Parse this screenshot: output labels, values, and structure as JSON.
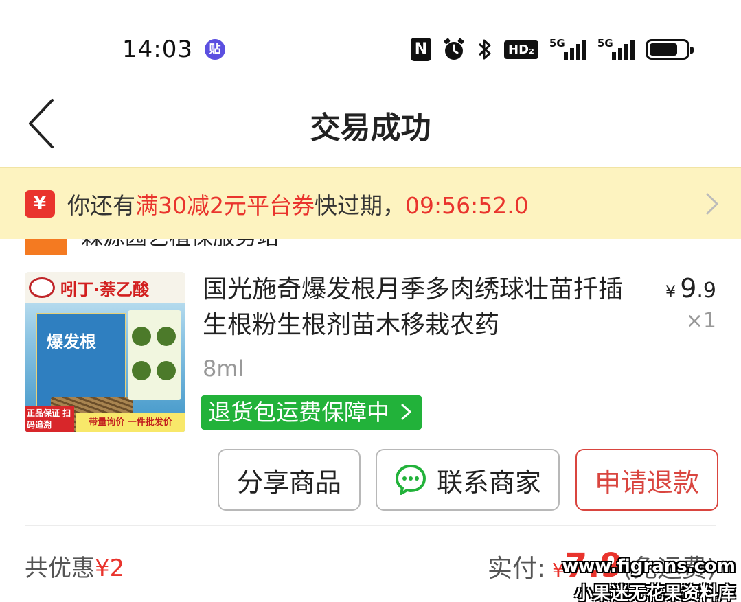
{
  "status_bar": {
    "time": "14:03",
    "notif_icon_label": "贴",
    "nfc_label": "N",
    "hd_label": "HD₂",
    "signal1_label": "5G",
    "signal2_label": "5G",
    "icons": [
      "nfc-icon",
      "alarm-icon",
      "bluetooth-icon",
      "hd-icon",
      "signal-icon",
      "signal-icon",
      "battery-icon"
    ]
  },
  "nav": {
    "title": "交易成功",
    "back_icon": "chevron-left-icon"
  },
  "coupon": {
    "icon_label": "¥",
    "text_prefix": "你还有",
    "text_highlight": "满30减2元平台券",
    "text_suffix": "快过期，",
    "countdown": "09:56:52.0"
  },
  "store": {
    "name": "森源园艺植保服务站"
  },
  "product": {
    "image_top_text": "吲丁·萘乙酸",
    "image_box_text": "爆发根",
    "image_badge1": "正品保证 扫码追溯",
    "image_badge2": "带量询价 一件批发价",
    "title": "国光施奇爆发根月季多肉绣球壮苗扦插生根粉生根剂苗木移栽农药",
    "price_currency": "¥",
    "price_int": "9",
    "price_dec": ".9",
    "quantity": "×1",
    "spec": "8ml",
    "guarantee": "退货包运费保障中"
  },
  "actions": {
    "share": "分享商品",
    "contact": "联系商家",
    "refund": "申请退款"
  },
  "summary": {
    "discount_label": "共优惠",
    "discount_amount": "¥2",
    "paid_label": "实付:",
    "paid_currency": "¥",
    "paid_amount": "7.9",
    "paid_note": "(免运费)"
  },
  "watermark": {
    "line1": "www.figrans.com",
    "line2": "小果迷无花果资料库"
  },
  "colors": {
    "accent_red": "#e9342d",
    "banner_bg": "#fdf3c0",
    "guarantee_green": "#22b23a"
  }
}
